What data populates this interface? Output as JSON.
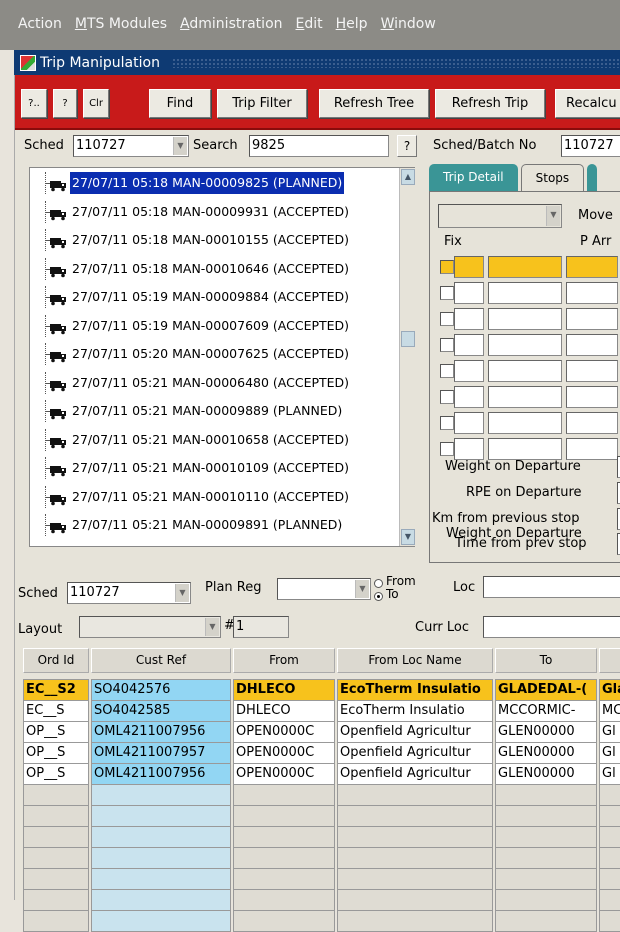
{
  "menu": [
    {
      "label": "Action",
      "ul": ""
    },
    {
      "label": "MTS Modules",
      "ul": "M"
    },
    {
      "label": "Administration",
      "ul": "A"
    },
    {
      "label": "Edit",
      "ul": "E"
    },
    {
      "label": "Help",
      "ul": "H"
    },
    {
      "label": "Window",
      "ul": "W"
    }
  ],
  "window_title": "Trip Manipulation",
  "toolbar": {
    "b1": "?..",
    "b2": "?",
    "b3": "Clr",
    "find": "Find",
    "trip_filter": "Trip Filter",
    "refresh_tree": "Refresh Tree",
    "refresh_trip": "Refresh Trip",
    "recalc": "Recalcu"
  },
  "search": {
    "sched_label": "Sched",
    "sched_value": "110727",
    "search_label": "Search",
    "search_value": "9825",
    "help": "?",
    "sched_batch_label": "Sched/Batch No",
    "sched_batch_value": "110727"
  },
  "tree_items": [
    "27/07/11 05:18 MAN-00009825 (PLANNED)",
    "27/07/11 05:18 MAN-00009931 (ACCEPTED)",
    "27/07/11 05:18 MAN-00010155 (ACCEPTED)",
    "27/07/11 05:18 MAN-00010646 (ACCEPTED)",
    "27/07/11 05:19 MAN-00009884 (ACCEPTED)",
    "27/07/11 05:19 MAN-00007609 (ACCEPTED)",
    "27/07/11 05:20 MAN-00007625 (ACCEPTED)",
    "27/07/11 05:21 MAN-00006480 (ACCEPTED)",
    "27/07/11 05:21 MAN-00009889 (PLANNED)",
    "27/07/11 05:21 MAN-00010658 (ACCEPTED)",
    "27/07/11 05:21 MAN-00010109 (ACCEPTED)",
    "27/07/11 05:21 MAN-00010110 (ACCEPTED)",
    "27/07/11 05:21 MAN-00009891 (PLANNED)"
  ],
  "tabs": [
    "Trip Detail",
    "Stops"
  ],
  "stops": {
    "move_label": "Move",
    "fix_label": "Fix",
    "parr_label": "P Arr",
    "weight_label": "Weight on Departure",
    "rpe_label": "RPE on Departure",
    "km_label": "Km from previous stop",
    "time_label": "Time from prev stop"
  },
  "filters": {
    "sched_label": "Sched",
    "sched_value": "110727",
    "plan_reg_label": "Plan Reg",
    "from_label": "From",
    "to_label": "To",
    "loc_label": "Loc",
    "layout_label": "Layout",
    "hash_label": "#",
    "hash_value": "1",
    "curr_loc_label": "Curr Loc"
  },
  "orders": {
    "columns": [
      "Ord Id",
      "Cust Ref",
      "From",
      "From Loc Name",
      "To",
      ""
    ],
    "rows": [
      [
        "EC__S2",
        "SO4042576",
        "DHLECO",
        "EcoTherm Insulatio",
        "GLADEDAL-(",
        "Gla"
      ],
      [
        "EC__S",
        "SO4042585",
        "DHLECO",
        "EcoTherm Insulatio",
        "MCCORMIC-",
        "MC"
      ],
      [
        "OP__S",
        "OML4211007956",
        "OPEN0000C",
        "Openfield Agricultur",
        "GLEN00000",
        "Gl"
      ],
      [
        "OP__S",
        "OML4211007957",
        "OPEN0000C",
        "Openfield Agricultur",
        "GLEN00000",
        "Gl"
      ],
      [
        "OP__S",
        "OML4211007956",
        "OPEN0000C",
        "Openfield Agricultur",
        "GLEN00000",
        "Gl"
      ]
    ]
  },
  "colors": {
    "toolbar_red": "#c81a1a",
    "title_blue": "#0e3a73",
    "highlight_yellow": "#f7c21c",
    "custref_blue": "#92d6f3",
    "tab_teal": "#3a9596",
    "selection_blue": "#0a2db0"
  }
}
